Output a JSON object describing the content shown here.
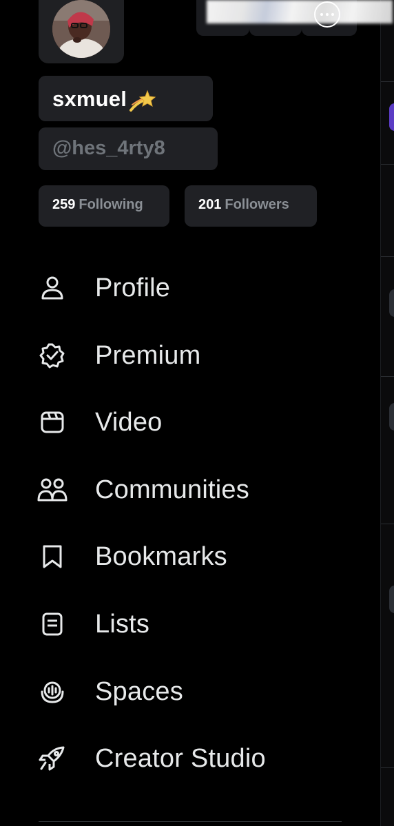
{
  "profile": {
    "display_name": "sxmuel",
    "name_emoji": "dizzy-star-emoji",
    "handle": "@hes_4rty8",
    "avatar": "user-avatar-photo"
  },
  "stats": {
    "following_count": "259",
    "following_label": "Following",
    "followers_count": "201",
    "followers_label": "Followers"
  },
  "header": {
    "more_icon": "more-horizontal-icon"
  },
  "menu": [
    {
      "label": "Profile",
      "icon": "person-icon"
    },
    {
      "label": "Premium",
      "icon": "verified-badge-icon"
    },
    {
      "label": "Video",
      "icon": "video-icon"
    },
    {
      "label": "Communities",
      "icon": "communities-icon"
    },
    {
      "label": "Bookmarks",
      "icon": "bookmark-icon"
    },
    {
      "label": "Lists",
      "icon": "list-icon"
    },
    {
      "label": "Spaces",
      "icon": "spaces-icon"
    },
    {
      "label": "Creator Studio",
      "icon": "rocket-icon"
    }
  ],
  "colors": {
    "background": "#000000",
    "pill": "#202125",
    "text_primary": "#e7e9ea",
    "text_muted": "#6f747a"
  }
}
